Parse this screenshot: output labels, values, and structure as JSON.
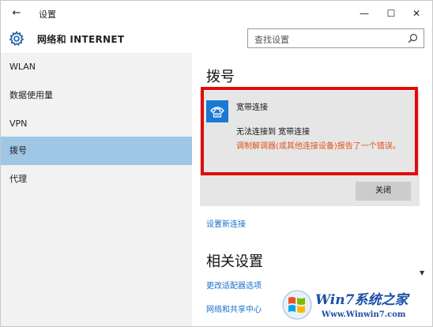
{
  "window": {
    "title": "设置",
    "back_icon": "←",
    "minimize_icon": "—",
    "maximize_icon": "☐",
    "close_icon": "✕"
  },
  "header": {
    "app_title": "网络和 INTERNET",
    "icon": "gear-icon"
  },
  "search": {
    "placeholder": "查找设置",
    "icon": "search-icon"
  },
  "sidebar": {
    "items": [
      {
        "label": "WLAN",
        "active": false
      },
      {
        "label": "数据使用量",
        "active": false
      },
      {
        "label": "VPN",
        "active": false
      },
      {
        "label": "拨号",
        "active": true
      },
      {
        "label": "代理",
        "active": false
      }
    ],
    "active_color": "#9fc6e4"
  },
  "main": {
    "section_title": "拨号",
    "connection": {
      "name": "宽带连接",
      "icon": "phone-icon",
      "status": "无法连接到 宽带连接",
      "error": "调制解调器(或其他连接设备)报告了一个错误。",
      "close_label": "关闭"
    },
    "new_connection_link": "设置新连接",
    "related_title": "相关设置",
    "related_links": [
      "更改适配器选项",
      "网络和共享中心"
    ]
  },
  "watermark": {
    "title": "Win7系统之家",
    "url": "Www.Winwin7.com"
  },
  "colors": {
    "accent": "#1a6fc8",
    "error": "#e0531b",
    "highlight_frame": "#e00b0b",
    "icon_bg": "#1a79d2"
  }
}
